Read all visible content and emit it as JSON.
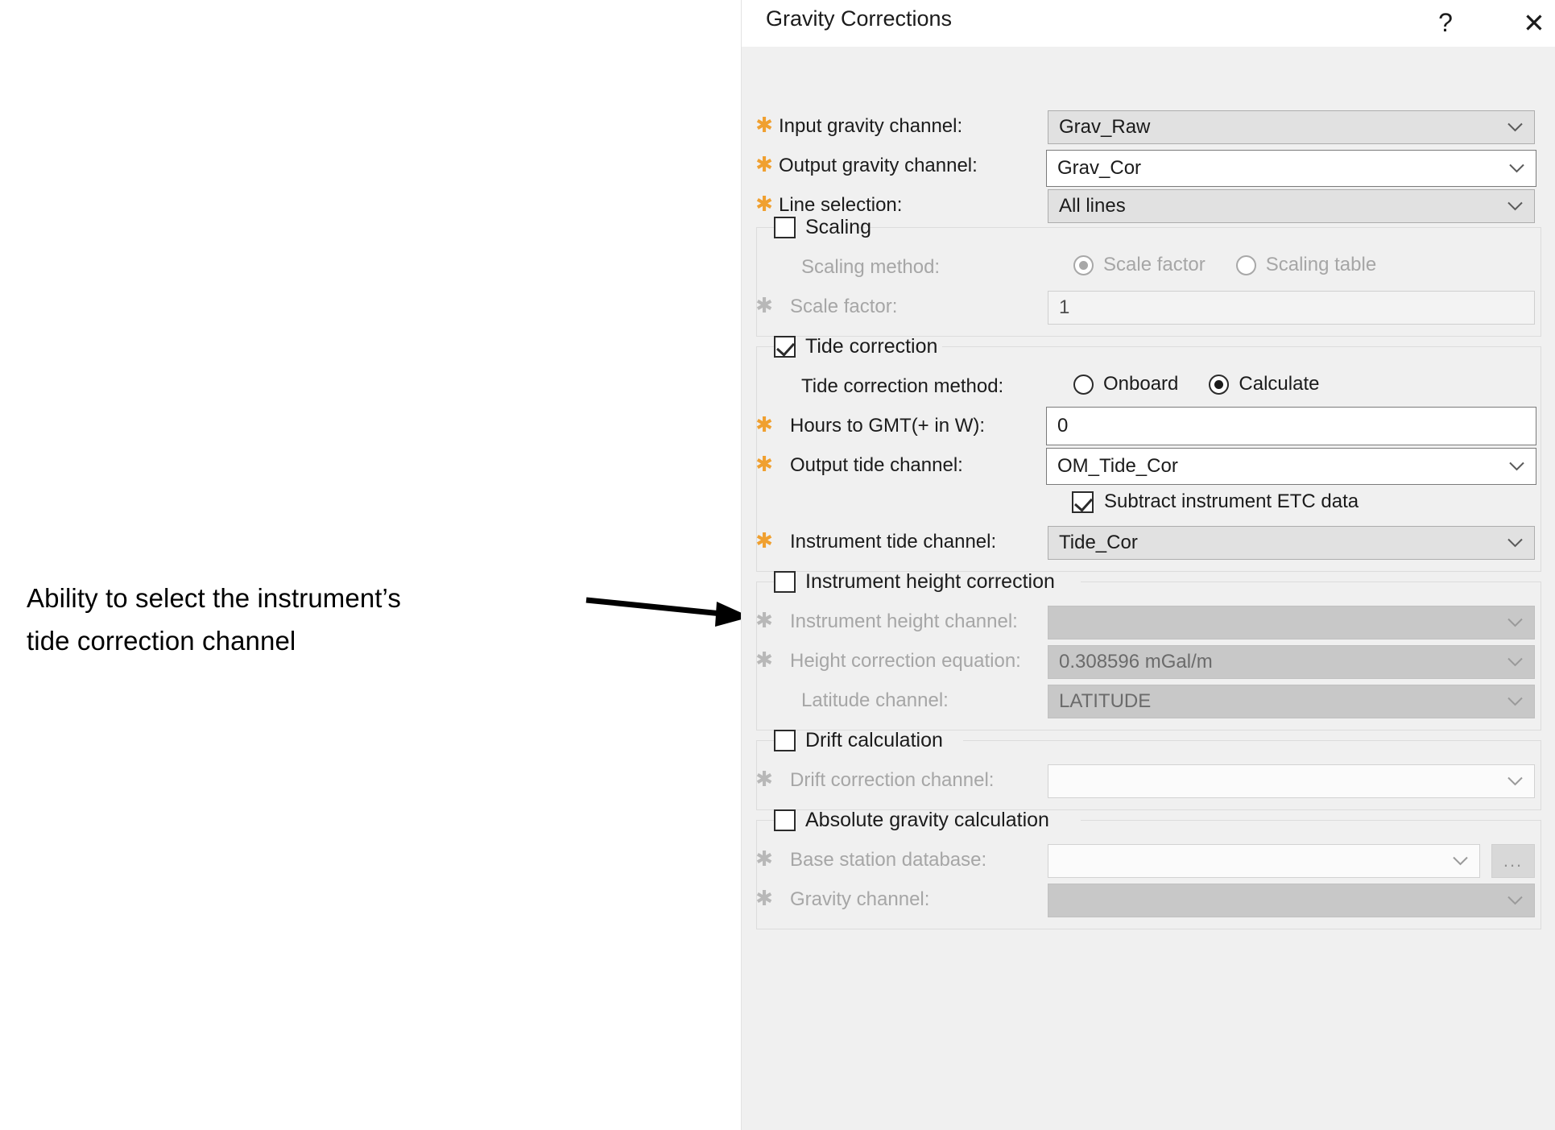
{
  "annotation": {
    "line1": "Ability to select the instrument’s",
    "line2": "tide correction channel",
    "arrow_icon": "arrow-right-icon"
  },
  "dialog": {
    "title": "Gravity Corrections",
    "help_label": "?",
    "close_label": "✕",
    "top_fields": [
      {
        "label": "Input gravity channel:",
        "value": "Grav_Raw",
        "required": true,
        "control": "combobox",
        "state": "readonly"
      },
      {
        "label": "Output gravity channel:",
        "value": "Grav_Cor",
        "required": true,
        "control": "combobox",
        "state": "focused"
      },
      {
        "label": "Line selection:",
        "value": "All lines",
        "required": true,
        "control": "combobox",
        "state": "readonly"
      }
    ],
    "groups": [
      {
        "title": "Scaling",
        "checked": false,
        "enabled": false,
        "rows": [
          {
            "label": "Scaling method:",
            "required": false,
            "control": "radiogroup",
            "options": [
              {
                "label": "Scale factor",
                "selected": true
              },
              {
                "label": "Scaling table",
                "selected": false
              }
            ]
          },
          {
            "label": "Scale factor:",
            "required": true,
            "control": "textbox",
            "value": "1",
            "state": "disabled"
          }
        ]
      },
      {
        "title": "Tide correction",
        "checked": true,
        "enabled": true,
        "rows": [
          {
            "label": "Tide correction method:",
            "required": false,
            "control": "radiogroup",
            "options": [
              {
                "label": "Onboard",
                "selected": false
              },
              {
                "label": "Calculate",
                "selected": true
              }
            ]
          },
          {
            "label": "Hours to GMT(+ in W):",
            "required": true,
            "control": "textbox",
            "value": "0",
            "state": "focused"
          },
          {
            "label": "Output tide channel:",
            "required": true,
            "control": "combobox",
            "value": "OM_Tide_Cor",
            "state": "focused"
          },
          {
            "label": "Subtract instrument ETC data",
            "control": "checkbox",
            "checked": true
          },
          {
            "label": "Instrument tide channel:",
            "required": true,
            "control": "combobox",
            "value": "Tide_Cor",
            "state": "readonly"
          }
        ]
      },
      {
        "title": "Instrument height correction",
        "checked": false,
        "enabled": false,
        "rows": [
          {
            "label": "Instrument height channel:",
            "required": true,
            "control": "combobox",
            "value": "",
            "state": "disabled"
          },
          {
            "label": "Height correction equation:",
            "required": true,
            "control": "combobox",
            "value": "0.308596 mGal/m",
            "state": "disabled"
          },
          {
            "label": "Latitude channel:",
            "required": false,
            "control": "combobox",
            "value": "LATITUDE",
            "state": "disabled"
          }
        ]
      },
      {
        "title": "Drift calculation",
        "checked": false,
        "enabled": false,
        "rows": [
          {
            "label": "Drift correction channel:",
            "required": true,
            "control": "combobox",
            "value": "",
            "state": "empty"
          }
        ]
      },
      {
        "title": "Absolute gravity calculation",
        "checked": false,
        "enabled": false,
        "rows": [
          {
            "label": "Base station database:",
            "required": true,
            "control": "combobox-browse",
            "value": "",
            "state": "empty",
            "browse_label": "..."
          },
          {
            "label": "Gravity channel:",
            "required": true,
            "control": "combobox",
            "value": "",
            "state": "disabled"
          }
        ]
      }
    ],
    "colors": {
      "required_asterisk": "#f0a030",
      "dialog_background": "#f0f0f0",
      "titlebar_background": "#ffffff",
      "text": "#1b1b1b",
      "disabled_text": "#a6a6a6"
    }
  }
}
